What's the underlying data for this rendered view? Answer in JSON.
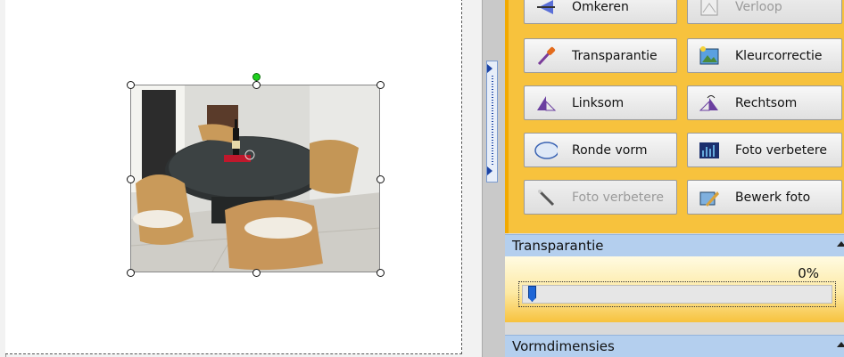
{
  "tools": [
    {
      "label": "Omkeren",
      "icon": "flip-icon",
      "enabled": true
    },
    {
      "label": "Verloop",
      "icon": "gradient-icon",
      "enabled": false
    },
    {
      "label": "Transparantie",
      "icon": "pipette-icon",
      "enabled": true
    },
    {
      "label": "Kleurcorrectie",
      "icon": "color-correction-icon",
      "enabled": true
    },
    {
      "label": "Linksom",
      "icon": "rotate-left-icon",
      "enabled": true
    },
    {
      "label": "Rechtsom",
      "icon": "rotate-right-icon",
      "enabled": true
    },
    {
      "label": "Ronde vorm",
      "icon": "round-shape-icon",
      "enabled": true
    },
    {
      "label": "Foto verbetere",
      "icon": "histogram-icon",
      "enabled": true
    },
    {
      "label": "Foto verbetere",
      "icon": "magic-wand-icon",
      "enabled": false
    },
    {
      "label": "Bewerk foto",
      "icon": "edit-photo-icon",
      "enabled": true
    }
  ],
  "transparency": {
    "title": "Transparantie",
    "value_label": "0%",
    "value": 0
  },
  "shape_dimensions": {
    "title": "Vormdimensies"
  },
  "colors": {
    "panel_orange": "#f7c23d",
    "header_blue": "#b4cfee",
    "slider_thumb": "#1f66d6",
    "rotate_handle": "#1fd11f"
  }
}
